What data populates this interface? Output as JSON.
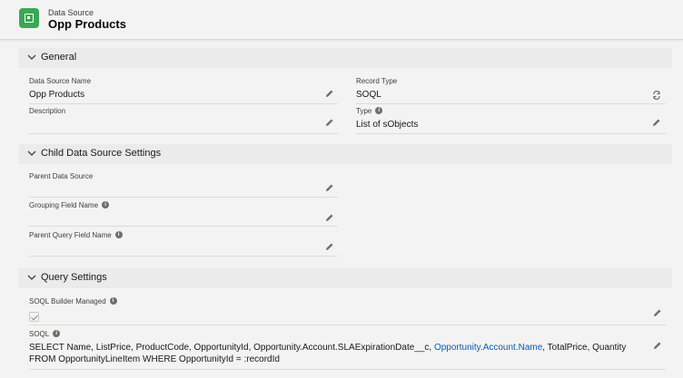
{
  "header": {
    "eyebrow": "Data Source",
    "title": "Opp Products",
    "icon": "data-source-icon",
    "icon_color": "#3ba755"
  },
  "sections": {
    "general": {
      "title": "General",
      "data_source_name": {
        "label": "Data Source Name",
        "value": "Opp Products"
      },
      "description": {
        "label": "Description",
        "value": ""
      },
      "record_type": {
        "label": "Record Type",
        "value": "SOQL"
      },
      "type": {
        "label": "Type",
        "value": "List of sObjects"
      }
    },
    "child": {
      "title": "Child Data Source Settings",
      "parent_data_source": {
        "label": "Parent Data Source",
        "value": ""
      },
      "grouping_field_name": {
        "label": "Grouping Field Name",
        "value": ""
      },
      "parent_query_field_name": {
        "label": "Parent Query Field Name",
        "value": ""
      }
    },
    "query": {
      "title": "Query Settings",
      "soql_builder_managed": {
        "label": "SOQL Builder Managed",
        "checked": true
      },
      "soql": {
        "label": "SOQL",
        "line1_prefix": "SELECT Name, ListPrice, ProductCode, OpportunityId, Opportunity.Account.SLAExpirationDate__c, ",
        "line1_link": "Opportunity.Account.Name",
        "line1_suffix": ", TotalPrice, Quantity",
        "line2": "FROM OpportunityLineItem WHERE OpportunityId = :recordId"
      }
    }
  },
  "colors": {
    "link": "#0b5cab",
    "background": "#f3f3f3",
    "section_header": "#ebebeb"
  }
}
